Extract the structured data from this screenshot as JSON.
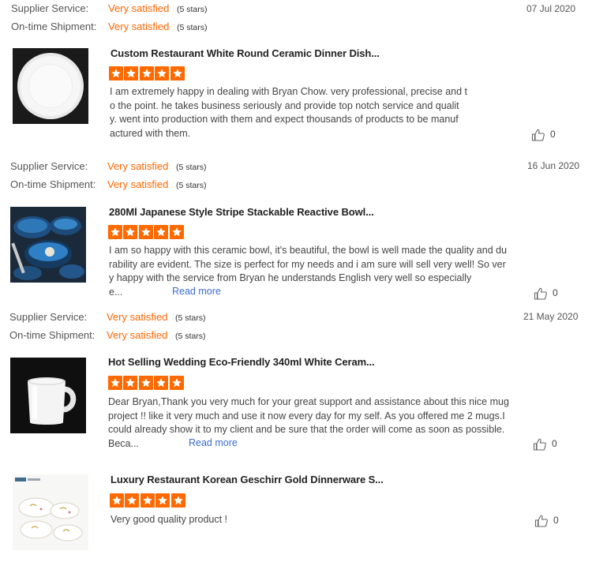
{
  "labels": {
    "supplier_service": "Supplier Service:",
    "ontime_shipment": "On-time Shipment:",
    "read_more": "Read more"
  },
  "colors": {
    "accent_orange": "#ff6a00",
    "link_blue": "#3b6cd1"
  },
  "reviews": [
    {
      "supplier_service_value": "Very satisfied",
      "supplier_service_stars": "(5 stars)",
      "ontime_shipment_value": "Very satisfied",
      "ontime_shipment_stars": "(5 stars)",
      "date": "07 Jul 2020",
      "product_title": "Custom Restaurant White Round Ceramic Dinner Dish...",
      "rating": 5,
      "body_lines": [
        "I am extremely happy in dealing with Bryan Chow.  very professional, precise and t",
        "o the point.  he takes  business seriously and provide top notch service and qualit",
        "y.  went into production with them and expect thousands of products to be manuf",
        "actured with them."
      ],
      "likes": "0",
      "thumb_icon": "white-round-plate"
    },
    {
      "supplier_service_value": "Very satisfied",
      "supplier_service_stars": "(5 stars)",
      "ontime_shipment_value": "Very satisfied",
      "ontime_shipment_stars": "(5 stars)",
      "date": "16 Jun 2020",
      "product_title": "280Ml Japanese Style Stripe Stackable Reactive Bowl...",
      "rating": 5,
      "body_lines": [
        "I am so happy with this ceramic bowl, it's beautiful, the bowl is well made the quality and du",
        "rability are evident.  The size is perfect for my needs and i am sure will sell very well!  So ver",
        "y happy with the service from Bryan he understands English very well so especially",
        "e..."
      ],
      "read_more": true,
      "likes": "0",
      "thumb_icon": "blue-reactive-bowls"
    },
    {
      "supplier_service_value": "Very satisfied",
      "supplier_service_stars": "(5 stars)",
      "ontime_shipment_value": "Very satisfied",
      "ontime_shipment_stars": "(5 stars)",
      "date": "21 May 2020",
      "product_title": "Hot Selling Wedding Eco-Friendly 340ml White Ceram...",
      "rating": 5,
      "body_lines": [
        "Dear Bryan,Thank you very much for your great support and assistance about this nice mug",
        "project !! like it very much and use it now every day for my self. As you offered me 2 mugs.I",
        "could already show it to my client and be sure that the order will come as soon as possible.",
        "Beca..."
      ],
      "read_more": true,
      "likes": "0",
      "thumb_icon": "white-mug"
    },
    {
      "product_title": "Luxury Restaurant Korean Geschirr Gold Dinnerware S...",
      "rating": 5,
      "body_lines": [
        "Very good quality product !"
      ],
      "likes": "0",
      "thumb_icon": "gold-dinnerware-set"
    }
  ]
}
